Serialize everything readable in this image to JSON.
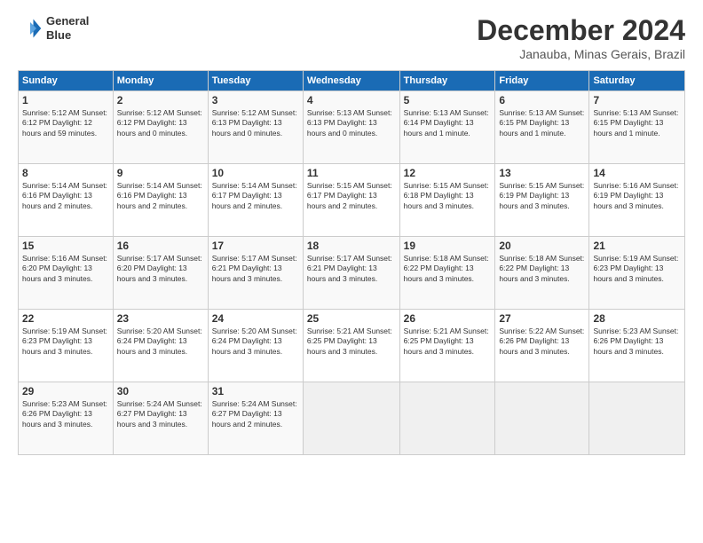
{
  "logo": {
    "line1": "General",
    "line2": "Blue"
  },
  "title": "December 2024",
  "subtitle": "Janauba, Minas Gerais, Brazil",
  "weekdays": [
    "Sunday",
    "Monday",
    "Tuesday",
    "Wednesday",
    "Thursday",
    "Friday",
    "Saturday"
  ],
  "weeks": [
    [
      {
        "day": "1",
        "info": "Sunrise: 5:12 AM\nSunset: 6:12 PM\nDaylight: 12 hours\nand 59 minutes."
      },
      {
        "day": "2",
        "info": "Sunrise: 5:12 AM\nSunset: 6:12 PM\nDaylight: 13 hours\nand 0 minutes."
      },
      {
        "day": "3",
        "info": "Sunrise: 5:12 AM\nSunset: 6:13 PM\nDaylight: 13 hours\nand 0 minutes."
      },
      {
        "day": "4",
        "info": "Sunrise: 5:13 AM\nSunset: 6:13 PM\nDaylight: 13 hours\nand 0 minutes."
      },
      {
        "day": "5",
        "info": "Sunrise: 5:13 AM\nSunset: 6:14 PM\nDaylight: 13 hours\nand 1 minute."
      },
      {
        "day": "6",
        "info": "Sunrise: 5:13 AM\nSunset: 6:15 PM\nDaylight: 13 hours\nand 1 minute."
      },
      {
        "day": "7",
        "info": "Sunrise: 5:13 AM\nSunset: 6:15 PM\nDaylight: 13 hours\nand 1 minute."
      }
    ],
    [
      {
        "day": "8",
        "info": "Sunrise: 5:14 AM\nSunset: 6:16 PM\nDaylight: 13 hours\nand 2 minutes."
      },
      {
        "day": "9",
        "info": "Sunrise: 5:14 AM\nSunset: 6:16 PM\nDaylight: 13 hours\nand 2 minutes."
      },
      {
        "day": "10",
        "info": "Sunrise: 5:14 AM\nSunset: 6:17 PM\nDaylight: 13 hours\nand 2 minutes."
      },
      {
        "day": "11",
        "info": "Sunrise: 5:15 AM\nSunset: 6:17 PM\nDaylight: 13 hours\nand 2 minutes."
      },
      {
        "day": "12",
        "info": "Sunrise: 5:15 AM\nSunset: 6:18 PM\nDaylight: 13 hours\nand 3 minutes."
      },
      {
        "day": "13",
        "info": "Sunrise: 5:15 AM\nSunset: 6:19 PM\nDaylight: 13 hours\nand 3 minutes."
      },
      {
        "day": "14",
        "info": "Sunrise: 5:16 AM\nSunset: 6:19 PM\nDaylight: 13 hours\nand 3 minutes."
      }
    ],
    [
      {
        "day": "15",
        "info": "Sunrise: 5:16 AM\nSunset: 6:20 PM\nDaylight: 13 hours\nand 3 minutes."
      },
      {
        "day": "16",
        "info": "Sunrise: 5:17 AM\nSunset: 6:20 PM\nDaylight: 13 hours\nand 3 minutes."
      },
      {
        "day": "17",
        "info": "Sunrise: 5:17 AM\nSunset: 6:21 PM\nDaylight: 13 hours\nand 3 minutes."
      },
      {
        "day": "18",
        "info": "Sunrise: 5:17 AM\nSunset: 6:21 PM\nDaylight: 13 hours\nand 3 minutes."
      },
      {
        "day": "19",
        "info": "Sunrise: 5:18 AM\nSunset: 6:22 PM\nDaylight: 13 hours\nand 3 minutes."
      },
      {
        "day": "20",
        "info": "Sunrise: 5:18 AM\nSunset: 6:22 PM\nDaylight: 13 hours\nand 3 minutes."
      },
      {
        "day": "21",
        "info": "Sunrise: 5:19 AM\nSunset: 6:23 PM\nDaylight: 13 hours\nand 3 minutes."
      }
    ],
    [
      {
        "day": "22",
        "info": "Sunrise: 5:19 AM\nSunset: 6:23 PM\nDaylight: 13 hours\nand 3 minutes."
      },
      {
        "day": "23",
        "info": "Sunrise: 5:20 AM\nSunset: 6:24 PM\nDaylight: 13 hours\nand 3 minutes."
      },
      {
        "day": "24",
        "info": "Sunrise: 5:20 AM\nSunset: 6:24 PM\nDaylight: 13 hours\nand 3 minutes."
      },
      {
        "day": "25",
        "info": "Sunrise: 5:21 AM\nSunset: 6:25 PM\nDaylight: 13 hours\nand 3 minutes."
      },
      {
        "day": "26",
        "info": "Sunrise: 5:21 AM\nSunset: 6:25 PM\nDaylight: 13 hours\nand 3 minutes."
      },
      {
        "day": "27",
        "info": "Sunrise: 5:22 AM\nSunset: 6:26 PM\nDaylight: 13 hours\nand 3 minutes."
      },
      {
        "day": "28",
        "info": "Sunrise: 5:23 AM\nSunset: 6:26 PM\nDaylight: 13 hours\nand 3 minutes."
      }
    ],
    [
      {
        "day": "29",
        "info": "Sunrise: 5:23 AM\nSunset: 6:26 PM\nDaylight: 13 hours\nand 3 minutes."
      },
      {
        "day": "30",
        "info": "Sunrise: 5:24 AM\nSunset: 6:27 PM\nDaylight: 13 hours\nand 3 minutes."
      },
      {
        "day": "31",
        "info": "Sunrise: 5:24 AM\nSunset: 6:27 PM\nDaylight: 13 hours\nand 2 minutes."
      },
      {
        "day": "",
        "info": ""
      },
      {
        "day": "",
        "info": ""
      },
      {
        "day": "",
        "info": ""
      },
      {
        "day": "",
        "info": ""
      }
    ]
  ]
}
